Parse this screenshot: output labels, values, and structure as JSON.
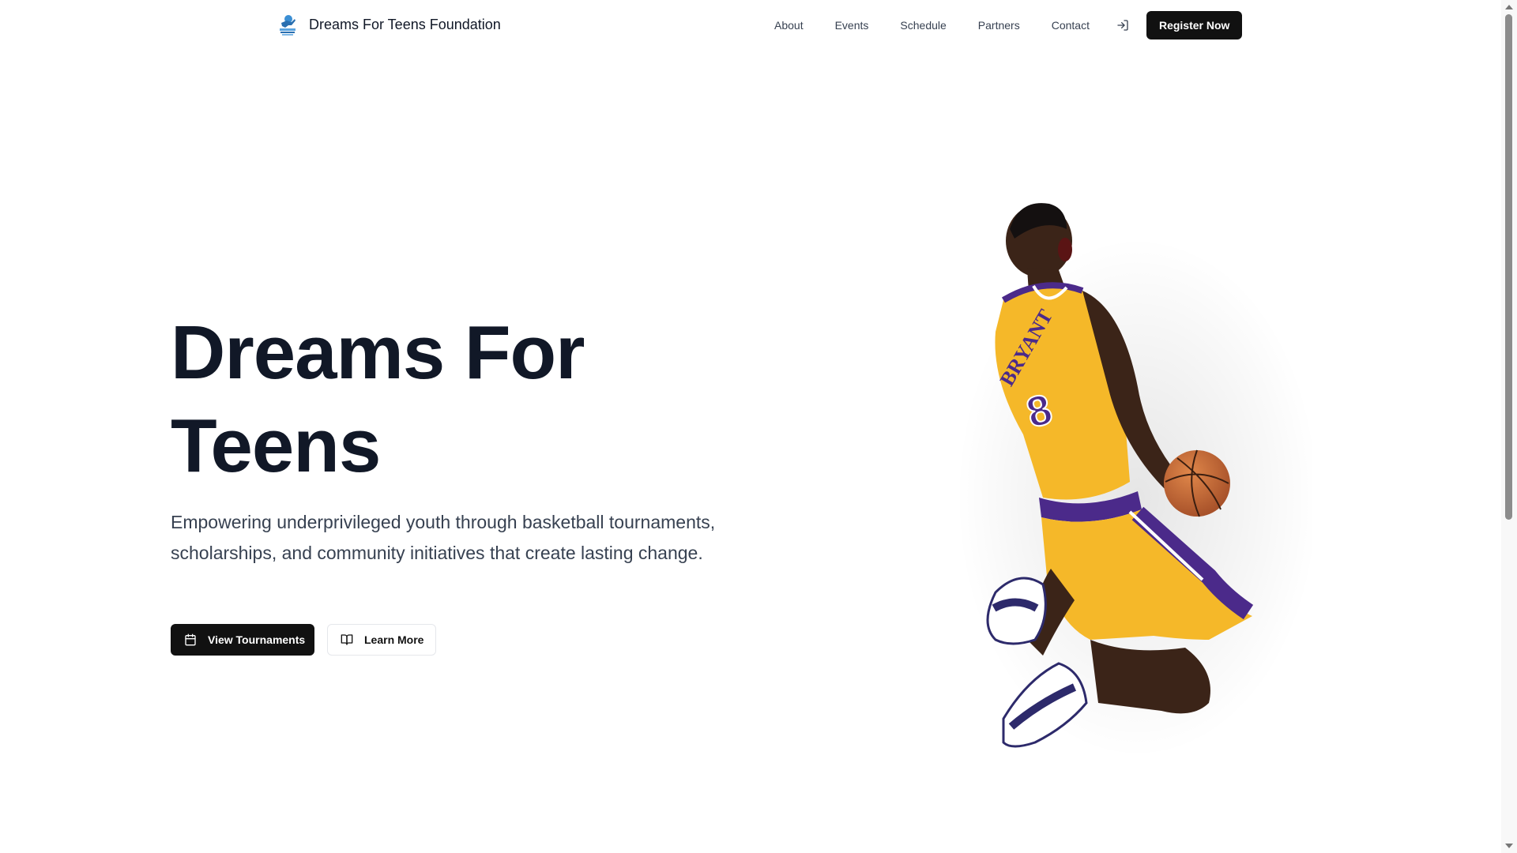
{
  "header": {
    "brand_name": "Dreams For Teens Foundation",
    "logo_icon": "basketball-player-logo-icon",
    "nav": [
      {
        "label": "About"
      },
      {
        "label": "Events"
      },
      {
        "label": "Schedule"
      },
      {
        "label": "Partners"
      },
      {
        "label": "Contact"
      }
    ],
    "login_icon": "login-icon",
    "register_label": "Register Now"
  },
  "hero": {
    "title_line1": "Dreams For",
    "title_line2": "Teens",
    "subtitle": "Empowering underprivileged youth through basketball tournaments, scholarships, and community initiatives that create lasting change.",
    "primary_button": {
      "label": "View Tournaments",
      "icon": "calendar-icon"
    },
    "secondary_button": {
      "label": "Learn More",
      "icon": "book-open-icon"
    },
    "image": {
      "subject": "basketball-player-dunk",
      "jersey_name": "BRYANT",
      "jersey_number": "8"
    }
  },
  "colors": {
    "primary": "#111111",
    "text": "#111827",
    "muted": "#374151",
    "jersey_gold": "#F5B829",
    "jersey_purple": "#4B2A8A"
  }
}
